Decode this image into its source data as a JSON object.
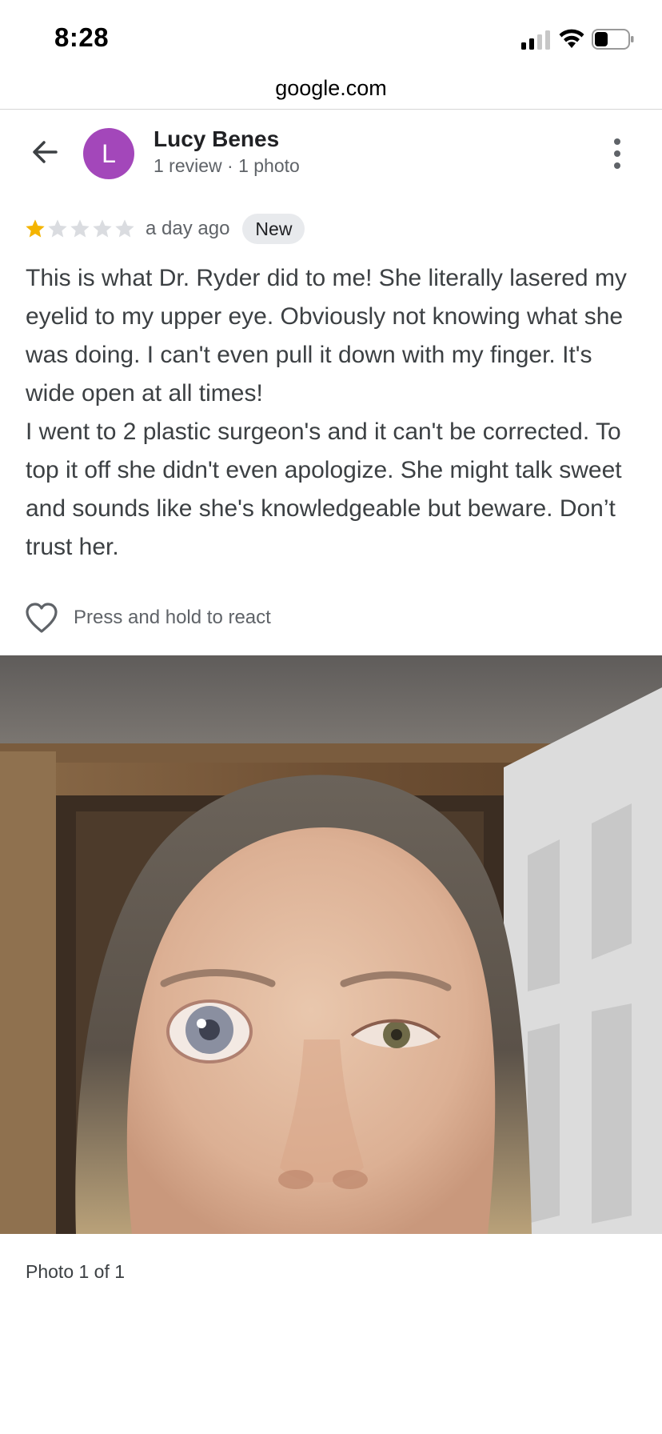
{
  "status_bar": {
    "time": "8:28",
    "icons": [
      "cellular-signal-icon",
      "wifi-icon",
      "battery-icon"
    ]
  },
  "browser": {
    "url": "google.com"
  },
  "header": {
    "back_icon": "back-arrow-icon",
    "avatar_letter": "L",
    "avatar_color": "#a347ba",
    "reviewer_name": "Lucy Benes",
    "reviewer_meta": "1 review · 1 photo",
    "menu_icon": "more-vert-icon"
  },
  "review": {
    "rating": 1,
    "max_rating": 5,
    "star_filled_color": "#f4b400",
    "star_empty_color": "#dadce0",
    "time": "a day ago",
    "badge": "New",
    "text": "This is what Dr. Ryder did to me! She literally lasered my eyelid to my upper eye. Obviously not knowing what she was doing. I can't even pull it down with my finger. It's wide open at all times!\nI went to 2 plastic surgeon's and it can't be corrected. To top it off she didn't even apologize. She might talk sweet and sounds like she's knowledgeable but beware. Don’t trust her."
  },
  "reactions": {
    "icon": "heart-outline-icon",
    "label": "Press and hold to react"
  },
  "photo": {
    "caption": "Photo 1 of 1"
  }
}
